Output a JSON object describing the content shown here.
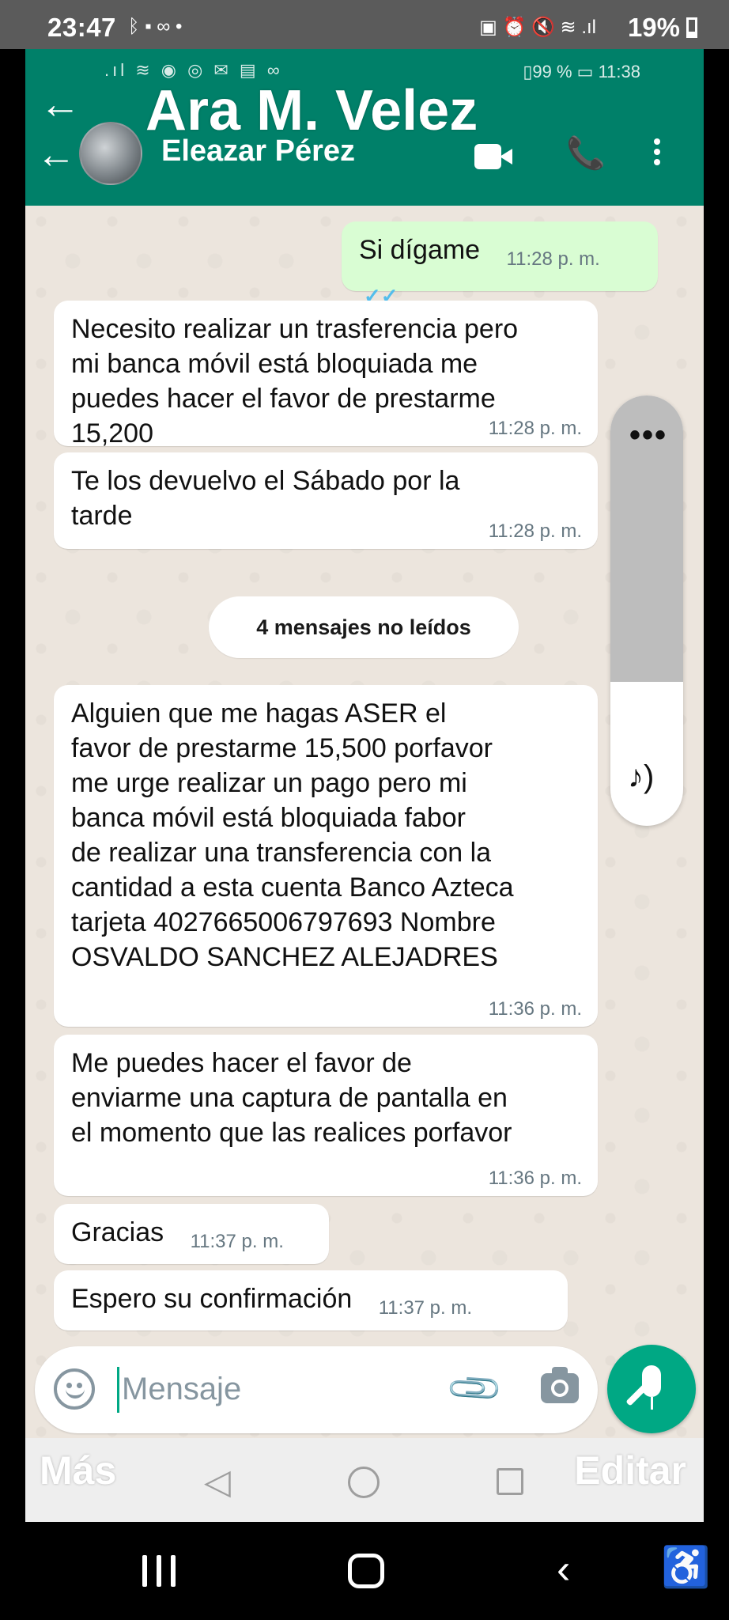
{
  "status_bar": {
    "time": "23:47",
    "left_icons": "ᛒ ▪ ∞ •",
    "right_icons": "▣ ⏰ 🔇 ≋ .ıl",
    "battery": "19%"
  },
  "inner_status": {
    "left_icons": ".ıl ≋ ◉ ◎ ✉ ▤ ∞",
    "right_text": "▯99 % ▭ 11:38"
  },
  "header": {
    "overlay_title": "Ara M. Velez",
    "contact_name": "Eleazar Pérez",
    "back_glyph": "←"
  },
  "messages": [
    {
      "dir": "out",
      "text": "Si dígame",
      "time": "11:28 p. m.",
      "ticks": "✓✓"
    },
    {
      "dir": "in",
      "text": "Necesito realizar un trasferencia pero\nmi banca móvil está bloquiada me\npuedes hacer el favor de prestarme\n15,200",
      "time": "11:28 p. m."
    },
    {
      "dir": "in",
      "text": "Te los devuelvo el Sábado por la\ntarde",
      "time": "11:28 p. m."
    },
    {
      "dir": "in",
      "text": "Alguien que me hagas ASER el\nfavor de prestarme 15,500 porfavor\nme urge realizar un pago pero mi\nbanca móvil está bloquiada fabor\nde realizar una transferencia con la\ncantidad a esta cuenta Banco Azteca\ntarjeta 4027665006797693 Nombre\nOSVALDO SANCHEZ ALEJADRES",
      "time": "11:36 p. m."
    },
    {
      "dir": "in",
      "text": "Me puedes hacer el favor de\nenviarme una captura de pantalla en\nel momento que las realices porfavor",
      "time": "11:36 p. m."
    },
    {
      "dir": "in",
      "text": "Gracias",
      "time": "11:37 p. m."
    },
    {
      "dir": "in",
      "text": "Espero su confirmación",
      "time": "11:37 p. m."
    }
  ],
  "unread_label": "4 mensajes no leídos",
  "input": {
    "placeholder": "Mensaje"
  },
  "overlay_words": {
    "left": "Más",
    "right": "Editar"
  },
  "icons": {
    "back": "arrow-left-icon",
    "video": "video-call-icon",
    "call": "phone-icon",
    "menu": "more-vert-icon",
    "emoji": "emoji-icon",
    "attach": "paperclip-icon",
    "camera": "camera-icon",
    "mic": "microphone-icon"
  },
  "colors": {
    "header": "#008069",
    "outgoing_bubble": "#d9fdd3",
    "accent": "#00a884",
    "read_ticks": "#53bdeb"
  }
}
